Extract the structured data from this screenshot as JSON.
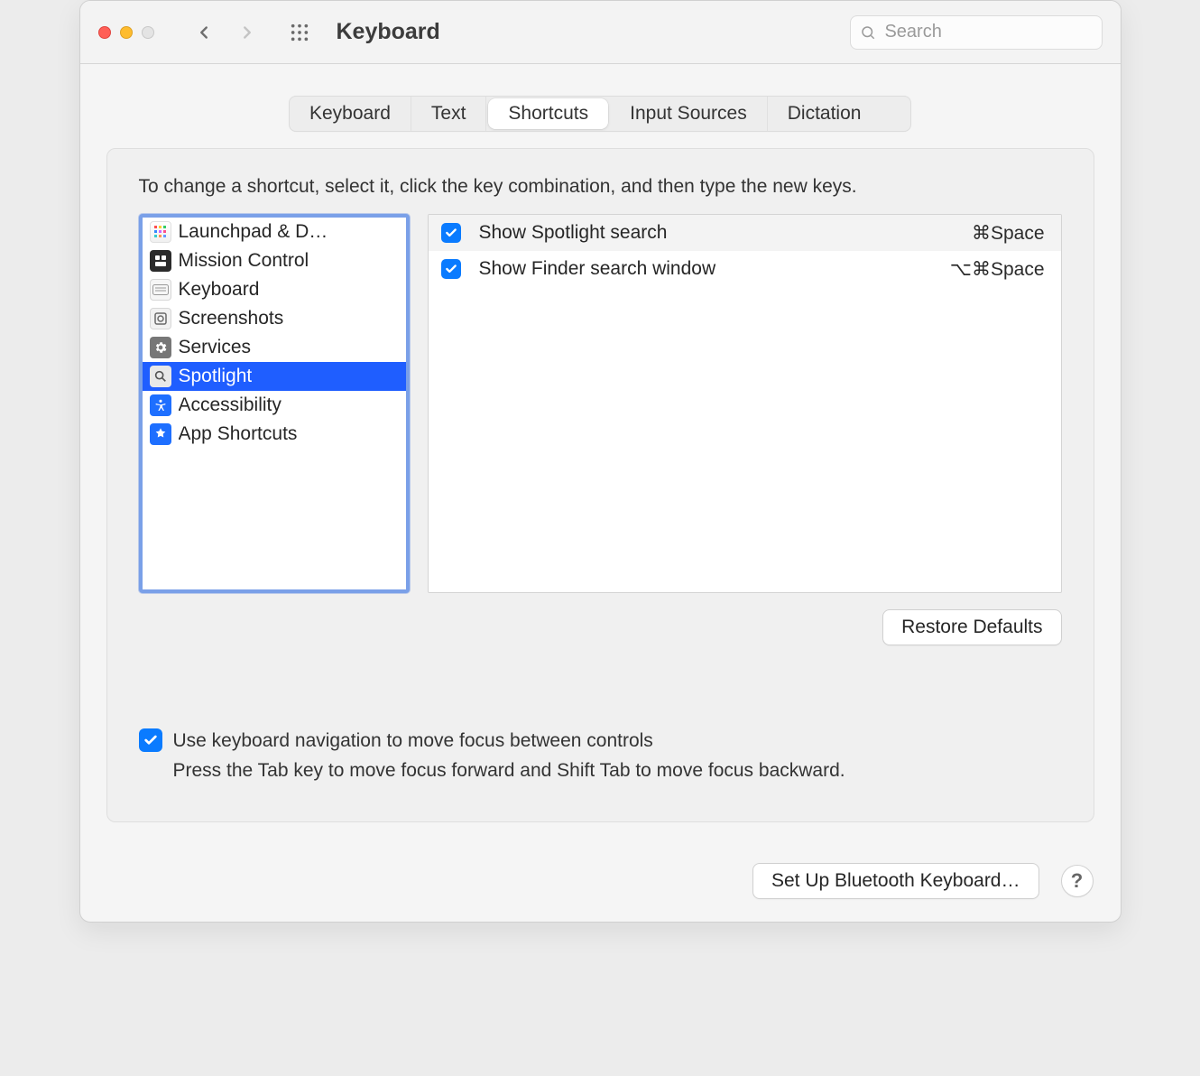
{
  "window": {
    "title": "Keyboard"
  },
  "search": {
    "placeholder": "Search",
    "value": ""
  },
  "tabs": [
    {
      "label": "Keyboard",
      "active": false
    },
    {
      "label": "Text",
      "active": false
    },
    {
      "label": "Shortcuts",
      "active": true
    },
    {
      "label": "Input Sources",
      "active": false
    },
    {
      "label": "Dictation",
      "active": false
    }
  ],
  "instruction": "To change a shortcut, select it, click the key combination, and then type the new keys.",
  "categories": [
    {
      "label": "Launchpad & D…",
      "selected": false,
      "icon": "launchpad"
    },
    {
      "label": "Mission Control",
      "selected": false,
      "icon": "mission"
    },
    {
      "label": "Keyboard",
      "selected": false,
      "icon": "keyboard"
    },
    {
      "label": "Screenshots",
      "selected": false,
      "icon": "screenshot"
    },
    {
      "label": "Services",
      "selected": false,
      "icon": "services"
    },
    {
      "label": "Spotlight",
      "selected": true,
      "icon": "spotlight"
    },
    {
      "label": "Accessibility",
      "selected": false,
      "icon": "access"
    },
    {
      "label": "App Shortcuts",
      "selected": false,
      "icon": "appsc"
    }
  ],
  "shortcuts": [
    {
      "enabled": true,
      "label": "Show Spotlight search",
      "keys": "⌘Space"
    },
    {
      "enabled": true,
      "label": "Show Finder search window",
      "keys": "⌥⌘Space"
    }
  ],
  "restore_defaults": "Restore Defaults",
  "keyboard_nav": {
    "enabled": true,
    "label": "Use keyboard navigation to move focus between controls",
    "hint": "Press the Tab key to move focus forward and Shift Tab to move focus backward."
  },
  "footer": {
    "bluetooth": "Set Up Bluetooth Keyboard…",
    "help": "?"
  }
}
